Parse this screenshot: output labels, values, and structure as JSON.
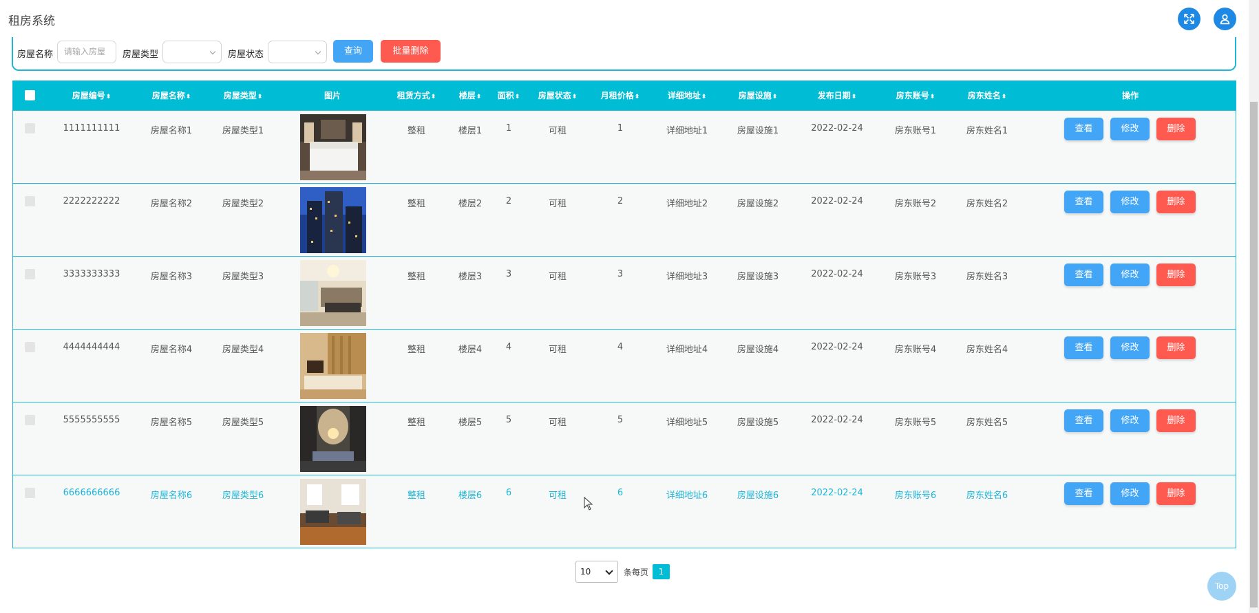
{
  "app": {
    "title": "租房系统"
  },
  "header": {
    "fullscreen_icon": "fullscreen-icon",
    "user_icon": "user-icon"
  },
  "search": {
    "name_label": "房屋名称",
    "name_placeholder": "请输入房屋",
    "type_label": "房屋类型",
    "type_value": "",
    "status_label": "房屋状态",
    "status_value": "",
    "query_label": "查询",
    "batch_delete_label": "批量删除"
  },
  "table": {
    "headers": {
      "code": "房屋编号",
      "name": "房屋名称",
      "type": "房屋类型",
      "image": "图片",
      "rent_mode": "租赁方式",
      "floor": "楼层",
      "area": "面积",
      "status": "房屋状态",
      "price": "月租价格",
      "address": "详细地址",
      "facility": "房屋设施",
      "date": "发布日期",
      "owner_account": "房东账号",
      "owner_name": "房东姓名",
      "ops": "操作"
    },
    "sort_glyph": "⬍",
    "rows": [
      {
        "code": "1111111111",
        "name": "房屋名称1",
        "type": "房屋类型1",
        "rent_mode": "整租",
        "floor": "楼层1",
        "area": "1",
        "status": "可租",
        "price": "1",
        "address": "详细地址1",
        "facility": "房屋设施1",
        "date": "2022-02-24",
        "owner_account": "房东账号1",
        "owner_name": "房东姓名1"
      },
      {
        "code": "2222222222",
        "name": "房屋名称2",
        "type": "房屋类型2",
        "rent_mode": "整租",
        "floor": "楼层2",
        "area": "2",
        "status": "可租",
        "price": "2",
        "address": "详细地址2",
        "facility": "房屋设施2",
        "date": "2022-02-24",
        "owner_account": "房东账号2",
        "owner_name": "房东姓名2"
      },
      {
        "code": "3333333333",
        "name": "房屋名称3",
        "type": "房屋类型3",
        "rent_mode": "整租",
        "floor": "楼层3",
        "area": "3",
        "status": "可租",
        "price": "3",
        "address": "详细地址3",
        "facility": "房屋设施3",
        "date": "2022-02-24",
        "owner_account": "房东账号3",
        "owner_name": "房东姓名3"
      },
      {
        "code": "4444444444",
        "name": "房屋名称4",
        "type": "房屋类型4",
        "rent_mode": "整租",
        "floor": "楼层4",
        "area": "4",
        "status": "可租",
        "price": "4",
        "address": "详细地址4",
        "facility": "房屋设施4",
        "date": "2022-02-24",
        "owner_account": "房东账号4",
        "owner_name": "房东姓名4"
      },
      {
        "code": "5555555555",
        "name": "房屋名称5",
        "type": "房屋类型5",
        "rent_mode": "整租",
        "floor": "楼层5",
        "area": "5",
        "status": "可租",
        "price": "5",
        "address": "详细地址5",
        "facility": "房屋设施5",
        "date": "2022-02-24",
        "owner_account": "房东账号5",
        "owner_name": "房东姓名5"
      },
      {
        "code": "6666666666",
        "name": "房屋名称6",
        "type": "房屋类型6",
        "rent_mode": "整租",
        "floor": "楼层6",
        "area": "6",
        "status": "可租",
        "price": "6",
        "address": "详细地址6",
        "facility": "房屋设施6",
        "date": "2022-02-24",
        "owner_account": "房东账号6",
        "owner_name": "房东姓名6"
      }
    ],
    "row_buttons": {
      "view": "查看",
      "edit": "修改",
      "delete": "删除"
    }
  },
  "pagination": {
    "page_size": "10",
    "per_page_label": "条每页",
    "current_page": "1"
  },
  "back_to_top": "Top",
  "colors": {
    "primary": "#42a5f5",
    "danger": "#ff5a4f",
    "header_bg": "#00bcd4",
    "accent": "#1fb5d6"
  }
}
